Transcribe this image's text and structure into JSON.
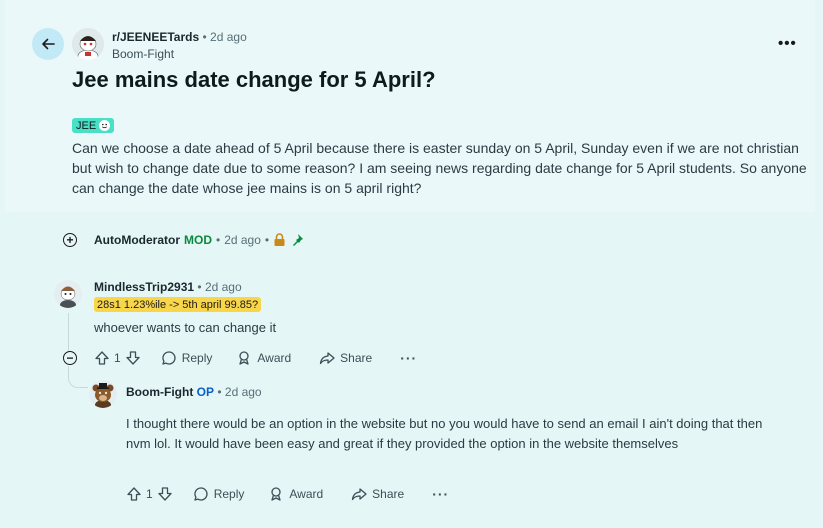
{
  "post": {
    "subreddit": "r/JEENEETards",
    "time": "2d ago",
    "author": "Boom-Fight",
    "title": "Jee mains date change for 5 April?",
    "flair": "JEE",
    "body": "Can we choose a date ahead of 5 April because there is easter sunday on 5 April, Sunday even if we are not christian but wish to change date due to some reason? I am seeing news regarding date change for 5 April students. So anyone can change the date whose jee mains is on 5 april right?",
    "more_label": "•••"
  },
  "automod": {
    "name": "AutoModerator",
    "tag": "MOD",
    "time": "2d ago",
    "expand_label": "+"
  },
  "comment1": {
    "author": "MindlessTrip2931",
    "time": "2d ago",
    "flair": "28s1 1.23%ile -> 5th april 99.85?",
    "text": "whoever wants to can change it",
    "score": "1",
    "reply_label": "Reply",
    "award_label": "Award",
    "share_label": "Share",
    "more_label": "···",
    "collapse_label": "−"
  },
  "comment2": {
    "author": "Boom-Fight",
    "tag": "OP",
    "time": "2d ago",
    "text": "I thought there would be an option in the website but no you would have to send an email I ain't doing that then nvm lol. It would have been easy and great if they provided the option in the website themselves",
    "score": "1",
    "reply_label": "Reply",
    "award_label": "Award",
    "share_label": "Share",
    "more_label": "···"
  },
  "colors": {
    "background": "#e5f6f7",
    "mod_green": "#0a8a3c",
    "op_blue": "#0a5fc4",
    "flair_teal": "#4ae0c6",
    "user_flair_yellow": "#f9d54a"
  },
  "icons": [
    "back-arrow-icon",
    "lock-icon",
    "pin-icon",
    "upvote-icon",
    "downvote-icon",
    "comment-icon",
    "award-icon",
    "share-icon"
  ]
}
